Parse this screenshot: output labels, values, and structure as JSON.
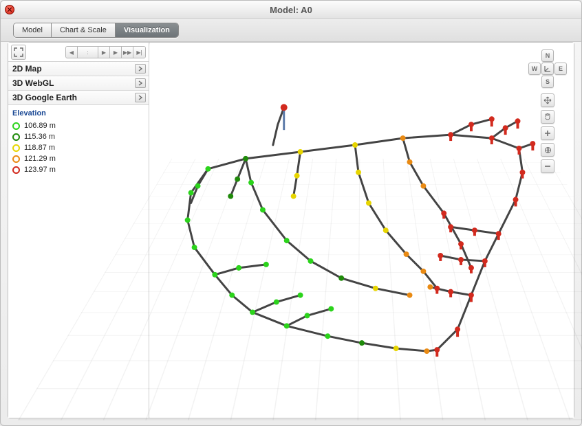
{
  "title": "Model: A0",
  "tabs": {
    "model": "Model",
    "chart": "Chart & Scale",
    "viz": "Visualization"
  },
  "active_tab": "viz",
  "views": {
    "map2d": "2D Map",
    "webgl": "3D WebGL",
    "gearth": "3D Google Earth"
  },
  "legend": {
    "title": "Elevation",
    "rows": [
      {
        "value": "106.89 m",
        "color": "#2bd31b"
      },
      {
        "value": "115.36 m",
        "color": "#1f8a0a"
      },
      {
        "value": "118.87 m",
        "color": "#e7d500"
      },
      {
        "value": "121.29 m",
        "color": "#e98a13"
      },
      {
        "value": "123.97 m",
        "color": "#d22a1e"
      }
    ]
  },
  "compass": {
    "n": "N",
    "s": "S",
    "e": "E",
    "w": "W"
  }
}
